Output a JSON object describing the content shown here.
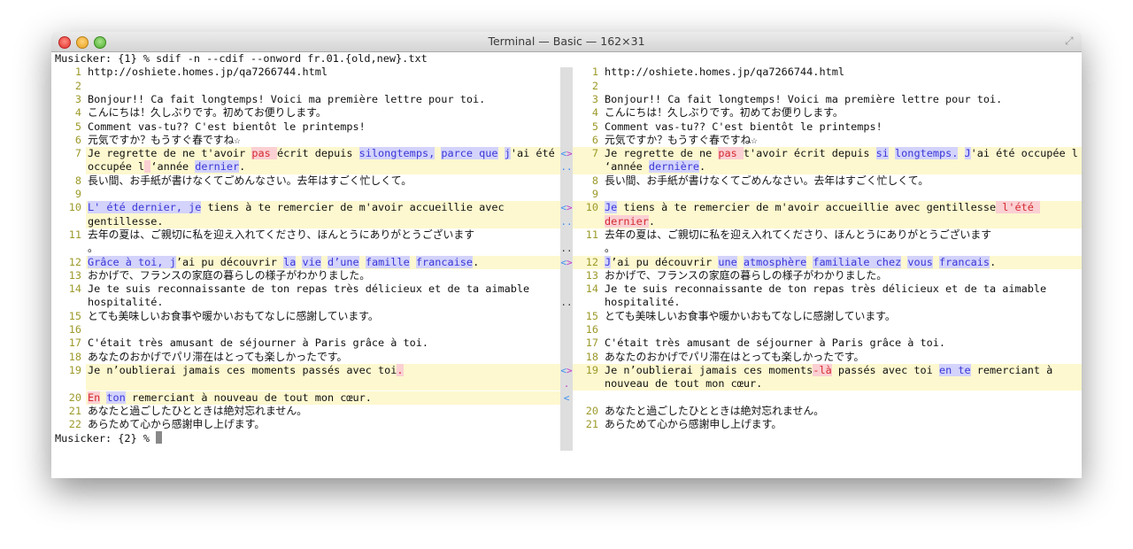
{
  "window": {
    "title": "Terminal — Basic — 162×31"
  },
  "terminal": {
    "command_prompt": "Musicker: {1} % ",
    "command": "sdif -n --cdif --onword fr.01.{old,new}.txt",
    "end_prompt": "Musicker: {2} % "
  },
  "colors": {
    "highlight": "#fdf8cf",
    "deleted": "#d42a2f",
    "added": "#3a36d6",
    "line_number": "#9d9a2b"
  },
  "rows": [
    {
      "ln": "1",
      "left": [
        {
          "t": "http://oshiete.homes.jp/qa7266744.html"
        }
      ],
      "mark": "",
      "rn": "1",
      "right": [
        {
          "t": "http://oshiete.homes.jp/qa7266744.html"
        }
      ]
    },
    {
      "ln": "2",
      "left": [],
      "mark": "",
      "rn": "2",
      "right": []
    },
    {
      "ln": "3",
      "left": [
        {
          "t": "Bonjour!! Ca fait longtemps! Voici ma première lettre pour toi."
        }
      ],
      "mark": "",
      "rn": "3",
      "right": [
        {
          "t": "Bonjour!! Ca fait longtemps! Voici ma première lettre pour toi."
        }
      ]
    },
    {
      "ln": "4",
      "left": [
        {
          "t": "こんにちは！久しぶりです。初めてお便りします。"
        }
      ],
      "mark": "",
      "rn": "4",
      "right": [
        {
          "t": "こんにちは！久しぶりです。初めてお便りします。"
        }
      ]
    },
    {
      "ln": "5",
      "left": [
        {
          "t": "Comment vas-tu?? C'est bientôt le printemps!"
        }
      ],
      "mark": "",
      "rn": "5",
      "right": [
        {
          "t": "Comment vas-tu?? C'est bientôt le printemps!"
        }
      ]
    },
    {
      "ln": "6",
      "left": [
        {
          "t": "元気ですか？もうすぐ春ですね☆"
        }
      ],
      "mark": "",
      "rn": "6",
      "right": [
        {
          "t": "元気ですか？もうすぐ春ですね☆"
        }
      ]
    },
    {
      "ln": "7",
      "hl": true,
      "rhl": true,
      "left": [
        {
          "t": "Je regrette de ne t'avoir "
        },
        {
          "t": "pas ",
          "c": "del"
        },
        {
          "t": "écrit depuis "
        },
        {
          "t": "silongtemps,",
          "c": "add"
        },
        {
          "t": " "
        },
        {
          "t": "parce que",
          "c": "add"
        },
        {
          "t": " "
        },
        {
          "t": "j",
          "c": "add"
        },
        {
          "t": "'ai été"
        }
      ],
      "mark": "<>",
      "rn": "7",
      "right": [
        {
          "t": "Je regrette de ne "
        },
        {
          "t": "pas ",
          "c": "del"
        },
        {
          "t": "t'avoir écrit depuis "
        },
        {
          "t": "si",
          "c": "add"
        },
        {
          "t": " "
        },
        {
          "t": "longtemps.",
          "c": "add"
        },
        {
          "t": " "
        },
        {
          "t": "J",
          "c": "add"
        },
        {
          "t": "'ai été occupée l"
        }
      ]
    },
    {
      "ln": "",
      "hl": true,
      "rhl": true,
      "left": [
        {
          "t": "occupée l"
        },
        {
          "t": " ",
          "c": "del"
        },
        {
          "t": "‘année "
        },
        {
          "t": "dernier",
          "c": "add"
        },
        {
          "t": "."
        }
      ],
      "mark": "..",
      "rn": "",
      "right": [
        {
          "t": "‘année "
        },
        {
          "t": "dernière",
          "c": "add"
        },
        {
          "t": "."
        }
      ]
    },
    {
      "ln": "8",
      "left": [
        {
          "t": "長い間、お手紙が書けなくてごめんなさい。去年はすごく忙しくて。"
        }
      ],
      "mark": "",
      "rn": "8",
      "right": [
        {
          "t": "長い間、お手紙が書けなくてごめんなさい。去年はすごく忙しくて。"
        }
      ]
    },
    {
      "ln": "9",
      "left": [],
      "mark": "",
      "rn": "9",
      "right": []
    },
    {
      "ln": "10",
      "hl": true,
      "rhl": true,
      "left": [
        {
          "t": "L' été dernier, je",
          "c": "add"
        },
        {
          "t": " tiens à te remercier de m'avoir accueillie avec"
        }
      ],
      "mark": "<>",
      "rn": "10",
      "right": [
        {
          "t": "Je",
          "c": "add"
        },
        {
          "t": " tiens à te remercier de m'avoir accueillie avec gentillesse"
        },
        {
          "t": " l'été ",
          "c": "del"
        }
      ]
    },
    {
      "ln": "",
      "hl": true,
      "rhl": true,
      "left": [
        {
          "t": "gentillesse."
        }
      ],
      "mark": "..",
      "rn": "",
      "right": [
        {
          "t": "dernier",
          "c": "del"
        },
        {
          "t": "."
        }
      ]
    },
    {
      "ln": "11",
      "left": [
        {
          "t": "去年の夏は、ご親切に私を迎え入れてくださり、ほんとうにありがとうございます"
        }
      ],
      "mark": "",
      "rn": "11",
      "right": [
        {
          "t": "去年の夏は、ご親切に私を迎え入れてくださり、ほんとうにありがとうございます"
        }
      ]
    },
    {
      "ln": "",
      "left": [
        {
          "t": "。"
        }
      ],
      "mark": "..",
      "mc": "#333",
      "rn": "",
      "right": [
        {
          "t": "。"
        }
      ]
    },
    {
      "ln": "12",
      "hl": true,
      "rhl": true,
      "left": [
        {
          "t": "Grâce à toi, j",
          "c": "add"
        },
        {
          "t": "’ai pu découvrir "
        },
        {
          "t": "la",
          "c": "add"
        },
        {
          "t": " "
        },
        {
          "t": "vie",
          "c": "add"
        },
        {
          "t": " "
        },
        {
          "t": "d’une",
          "c": "add"
        },
        {
          "t": " "
        },
        {
          "t": "famille",
          "c": "add"
        },
        {
          "t": " "
        },
        {
          "t": "francaise",
          "c": "add"
        },
        {
          "t": "."
        }
      ],
      "mark": "<>",
      "rn": "12",
      "right": [
        {
          "t": "J",
          "c": "add"
        },
        {
          "t": "’ai pu découvrir "
        },
        {
          "t": "une",
          "c": "add"
        },
        {
          "t": " "
        },
        {
          "t": "atmosphère",
          "c": "add"
        },
        {
          "t": " "
        },
        {
          "t": "familiale chez",
          "c": "add"
        },
        {
          "t": " "
        },
        {
          "t": "vous",
          "c": "add"
        },
        {
          "t": " "
        },
        {
          "t": "francais",
          "c": "add"
        },
        {
          "t": "."
        }
      ]
    },
    {
      "ln": "13",
      "left": [
        {
          "t": "おかげで、フランスの家庭の暮らしの様子がわかりました。"
        }
      ],
      "mark": "",
      "rn": "13",
      "right": [
        {
          "t": "おかげで、フランスの家庭の暮らしの様子がわかりました。"
        }
      ]
    },
    {
      "ln": "14",
      "left": [
        {
          "t": "Je te suis reconnaissante de ton repas très délicieux et de ta aimable"
        }
      ],
      "mark": "",
      "rn": "14",
      "right": [
        {
          "t": "Je te suis reconnaissante de ton repas très délicieux et de ta aimable"
        }
      ]
    },
    {
      "ln": "",
      "left": [
        {
          "t": "hospitalité."
        }
      ],
      "mark": "..",
      "mc": "#333",
      "rn": "",
      "right": [
        {
          "t": "hospitalité."
        }
      ]
    },
    {
      "ln": "15",
      "left": [
        {
          "t": "とても美味しいお食事や暖かいおもてなしに感謝しています。"
        }
      ],
      "mark": "",
      "rn": "15",
      "right": [
        {
          "t": "とても美味しいお食事や暖かいおもてなしに感謝しています。"
        }
      ]
    },
    {
      "ln": "16",
      "left": [],
      "mark": "",
      "rn": "16",
      "right": []
    },
    {
      "ln": "17",
      "left": [
        {
          "t": "C'était très amusant de séjourner à Paris grâce à toi."
        }
      ],
      "mark": "",
      "rn": "17",
      "right": [
        {
          "t": "C'était très amusant de séjourner à Paris grâce à toi."
        }
      ]
    },
    {
      "ln": "18",
      "left": [
        {
          "t": "あなたのおかげでパリ滞在はとっても楽しかったです。"
        }
      ],
      "mark": "",
      "rn": "18",
      "right": [
        {
          "t": "あなたのおかげでパリ滞在はとっても楽しかったです。"
        }
      ]
    },
    {
      "ln": "19",
      "hl": true,
      "rhl": true,
      "left": [
        {
          "t": "Je n’oublierai jamais ces moments passés avec toi"
        },
        {
          "t": ".",
          "c": "del"
        }
      ],
      "mark": "<>",
      "rn": "19",
      "right": [
        {
          "t": "Je n’oublierai jamais ces moments"
        },
        {
          "t": "-là",
          "c": "del"
        },
        {
          "t": " passés avec toi "
        },
        {
          "t": "en te",
          "c": "add"
        },
        {
          "t": " remerciant à"
        }
      ]
    },
    {
      "ln": "",
      "hl": true,
      "rhl": true,
      "left": [],
      "mark": ".",
      "mc": "#c23bc2",
      "rn": "",
      "right": [
        {
          "t": "nouveau de tout mon cœur."
        }
      ]
    },
    {
      "ln": "20",
      "hl": true,
      "rhl": false,
      "left": [
        {
          "t": "En",
          "c": "del"
        },
        {
          "t": " "
        },
        {
          "t": "ton",
          "c": "add"
        },
        {
          "t": " remerciant à nouveau de tout mon cœur."
        }
      ],
      "mark": "<",
      "rn": "",
      "right": []
    },
    {
      "ln": "21",
      "left": [
        {
          "t": "あなたと過ごしたひとときは絶対忘れません。"
        }
      ],
      "mark": "",
      "rn": "20",
      "right": [
        {
          "t": "あなたと過ごしたひとときは絶対忘れません。"
        }
      ]
    },
    {
      "ln": "22",
      "left": [
        {
          "t": "あらためて心から感謝申し上げます。"
        }
      ],
      "mark": "",
      "rn": "21",
      "right": [
        {
          "t": "あらためて心から感謝申し上げます。"
        }
      ]
    }
  ]
}
